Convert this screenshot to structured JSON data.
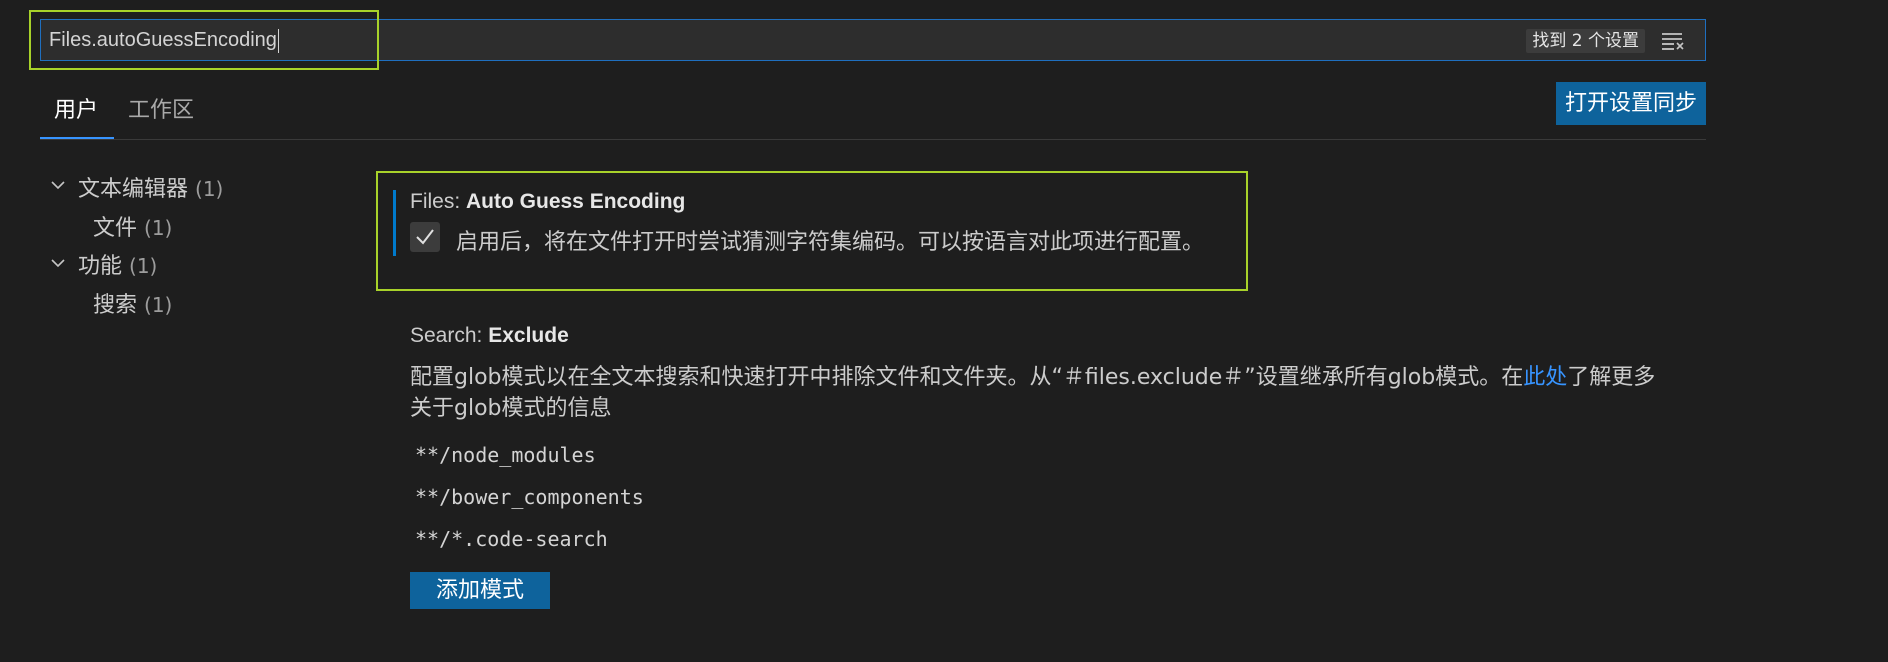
{
  "search": {
    "value": "Files.autoGuessEncoding",
    "results_label": "找到 2 个设置",
    "filter_icon": "filter-lines-icon"
  },
  "tabs": [
    {
      "label": "用户",
      "active": true
    },
    {
      "label": "工作区",
      "active": false
    }
  ],
  "sync_button_label": "打开设置同步",
  "toc": [
    {
      "label": "文本编辑器",
      "count": "(1)",
      "expanded": true,
      "children": [
        {
          "label": "文件",
          "count": "(1)"
        }
      ]
    },
    {
      "label": "功能",
      "count": "(1)",
      "expanded": true,
      "children": [
        {
          "label": "搜索",
          "count": "(1)"
        }
      ]
    }
  ],
  "settings": [
    {
      "category": "Files: ",
      "name": "Auto Guess Encoding",
      "checked": true,
      "description": "启用后，将在文件打开时尝试猜测字符集编码。可以按语言对此项进行配置。"
    },
    {
      "category": "Search: ",
      "name": "Exclude",
      "description_line1_prefix": "配置glob模式以在全文本搜索和快速打开中排除文件和文件夹。从“＃files.exclude＃”设置继承所有glob模式。在",
      "description_link": "此处",
      "description_line1_suffix": "了解更多",
      "description_line2": "关于glob模式的信息",
      "patterns": [
        "**/node_modules",
        "**/bower_components",
        "**/*.code-search"
      ],
      "add_button_label": "添加模式"
    }
  ],
  "colors": {
    "background": "#1e1e1e",
    "accent_button": "#0e639c",
    "highlight_border": "#a8d22a",
    "link": "#3794ff"
  }
}
